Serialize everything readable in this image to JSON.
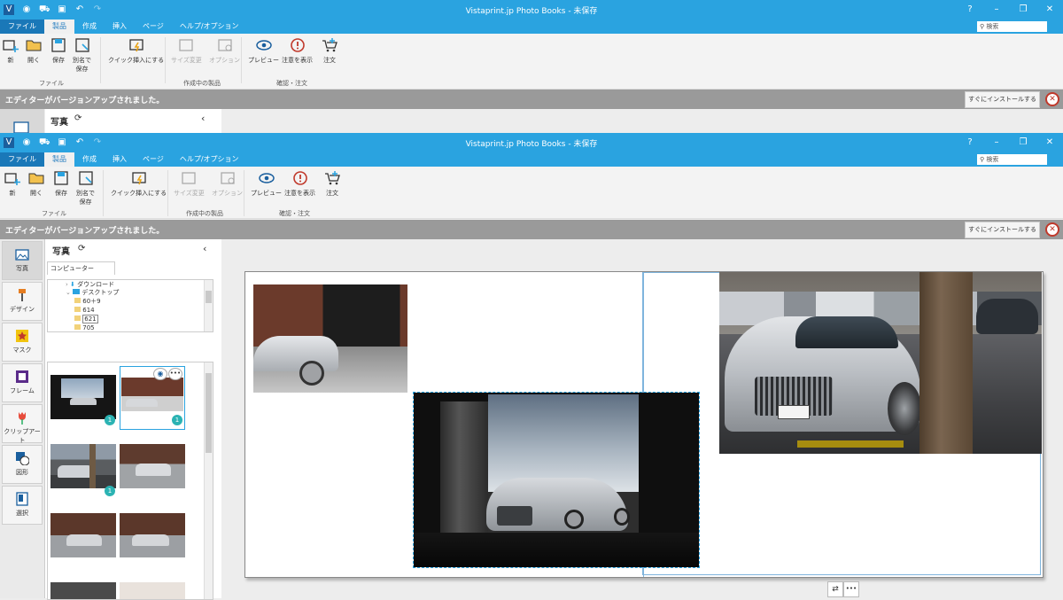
{
  "window": {
    "title": "Vistaprint.jp Photo Books - 未保存",
    "controls": [
      "?",
      "–",
      "❐",
      "✕"
    ],
    "quick_access": [
      "V",
      "◉",
      "🛒",
      "▣",
      "↶",
      "↷"
    ]
  },
  "menu": {
    "tabs": [
      "ファイル",
      "製品",
      "作成",
      "挿入",
      "ページ",
      "ヘルプ/オプション"
    ],
    "search_placeholder": "検索"
  },
  "ribbon": {
    "buttons": {
      "new": "新",
      "open": "開く",
      "save": "保存",
      "save_as_1": "別名で",
      "save_as_2": "保存",
      "quick_insert": "クイック挿入にする",
      "resize": "サイズ変更",
      "options": "オプション",
      "preview": "プレビュー",
      "warnings": "注意を表示",
      "order": "注文"
    },
    "groups": {
      "file": "ファイル",
      "product": "作成中の製品",
      "confirm": "確認・注文"
    }
  },
  "notice": {
    "message": "エディターがバージョンアップされました。",
    "install_label": "すぐにインストールする",
    "close_glyph": "✕"
  },
  "panel": {
    "title": "写真",
    "refresh_glyph": "⟳",
    "collapse_glyph": "‹",
    "tab": "コンピューター",
    "tree": [
      "ダウンロード",
      "デスクトップ",
      "60＋9",
      "614",
      "621",
      "705"
    ]
  },
  "rail": [
    "写真",
    "デザイン",
    "マスク",
    "フレーム",
    "クリップアート",
    "図形",
    "選択"
  ],
  "thumbs": {
    "badges": [
      "1",
      "1",
      "1"
    ]
  },
  "canvas": {
    "bottom_tools": [
      "⇄",
      "•••"
    ]
  },
  "colors": {
    "accent": "#2aa3e0",
    "notice": "#9a9a9a",
    "badge": "#2bb3b3"
  }
}
